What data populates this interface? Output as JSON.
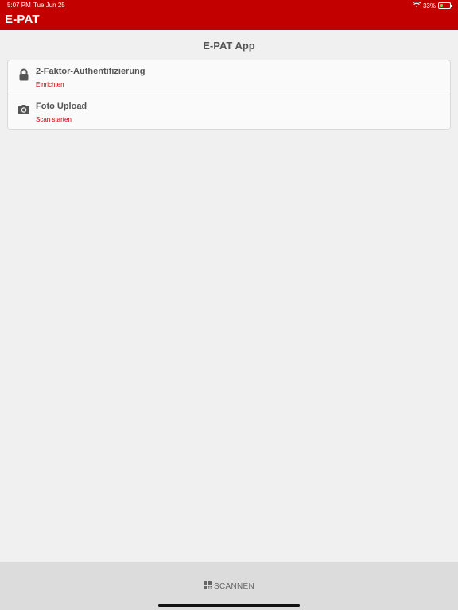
{
  "status_bar": {
    "time": "5:07 PM",
    "date": "Tue Jun 25",
    "battery": "33%",
    "battery_level": 0.33
  },
  "app_bar": {
    "title": "E-PAT"
  },
  "main": {
    "page_title": "E-PAT App",
    "items": [
      {
        "icon": "lock-icon",
        "title": "2-Faktor-Authentifizierung",
        "subtitle": "Einrichten"
      },
      {
        "icon": "camera-icon",
        "title": "Foto Upload",
        "subtitle": "Scan starten"
      }
    ]
  },
  "bottom_bar": {
    "scan_label": "SCANNEN",
    "scan_icon": "qr-code-icon"
  },
  "colors": {
    "brand": "#c20000",
    "background": "#f0f0f0",
    "text": "#555555"
  }
}
